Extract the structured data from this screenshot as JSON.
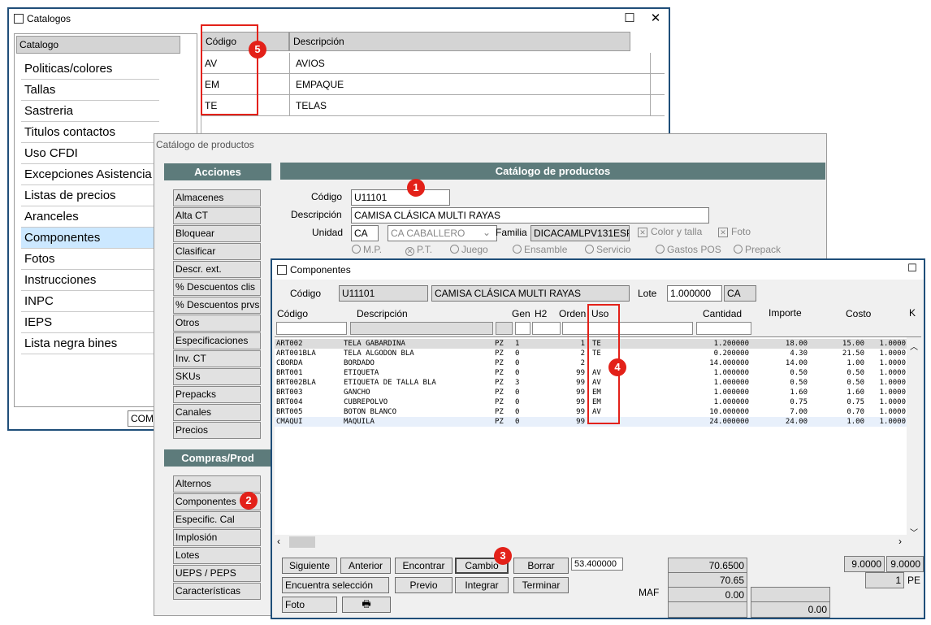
{
  "catalogos": {
    "title": "Catalogos",
    "list_header": "Catalogo",
    "items": [
      "Politicas/colores",
      "Tallas",
      "Sastreria",
      "Titulos contactos",
      "Uso CFDI",
      "Excepciones Asistencia",
      "Listas de precios",
      "Aranceles",
      "Componentes",
      "Fotos",
      "Instrucciones",
      "INPC",
      "IEPS",
      "Lista negra bines"
    ],
    "selected_index": 8,
    "grid_headers": [
      "Código",
      "Descripción"
    ],
    "rows": [
      {
        "code": "AV",
        "desc": "AVIOS"
      },
      {
        "code": "EM",
        "desc": "EMPAQUE"
      },
      {
        "code": "TE",
        "desc": "TELAS"
      }
    ],
    "bottom_field": "COM"
  },
  "productos": {
    "title": "Catálogo de productos",
    "acciones_header": "Acciones",
    "main_header": "Catálogo de productos",
    "acciones": [
      "Almacenes",
      "Alta CT",
      "Bloquear",
      "Clasificar",
      "Descr. ext.",
      "% Descuentos clis",
      "% Descuentos prvs",
      "Otros",
      "Especificaciones",
      "Inv. CT",
      "SKUs",
      "Prepacks",
      "Canales",
      "Precios"
    ],
    "compras_header": "Compras/Prod",
    "compras": [
      "Alternos",
      "Componentes",
      "Especific. Cal",
      "Implosión",
      "Lotes",
      "UEPS / PEPS",
      "Características"
    ],
    "codigo_label": "Código",
    "codigo_value": "U11101",
    "descripcion_label": "Descripción",
    "descripcion_value": "CAMISA CLÁSICA MULTI RAYAS",
    "unidad_label": "Unidad",
    "unidad_value": "CA",
    "unidad_select": "CA  CABALLERO",
    "familia_label": "Familia",
    "familia_value": "DICACAMLPV131ESP",
    "check_color": "Color y talla",
    "check_foto": "Foto",
    "radios": [
      "M.P.",
      "P.T.",
      "Juego",
      "Ensamble",
      "Servicio",
      "Gastos POS",
      "Prepack"
    ],
    "radio_selected": 1
  },
  "componentes": {
    "title": "Componentes",
    "codigo_label": "Código",
    "codigo_value": "U11101",
    "desc_value": "CAMISA CLÁSICA MULTI RAYAS",
    "lote_label": "Lote",
    "lote_value": "1.000000",
    "lote_unit": "CA",
    "headers": {
      "codigo": "Código",
      "descripcion": "Descripción",
      "gen": "Gen",
      "h2": "H2",
      "orden": "Orden",
      "uso": "Uso",
      "cantidad": "Cantidad",
      "importe": "Importe",
      "costo": "Costo",
      "k": "K"
    },
    "rows": [
      {
        "codigo": "ART002",
        "desc": "TELA GABARDINA",
        "um": "PZ",
        "gen": "1",
        "orden": "1",
        "uso": "TE",
        "cantidad": "1.200000",
        "importe": "18.00",
        "costo": "15.00",
        "k": "1.0000"
      },
      {
        "codigo": "ART001BLA",
        "desc": "TELA ALGODON BLA",
        "um": "PZ",
        "gen": "0",
        "orden": "2",
        "uso": "TE",
        "cantidad": "0.200000",
        "importe": "4.30",
        "costo": "21.50",
        "k": "1.0000"
      },
      {
        "codigo": "CBORDA",
        "desc": "BORDADO",
        "um": "PZ",
        "gen": "0",
        "orden": "2",
        "uso": "",
        "cantidad": "14.000000",
        "importe": "14.00",
        "costo": "1.00",
        "k": "1.0000"
      },
      {
        "codigo": "BRT001",
        "desc": "ETIQUETA",
        "um": "PZ",
        "gen": "0",
        "orden": "99",
        "uso": "AV",
        "cantidad": "1.000000",
        "importe": "0.50",
        "costo": "0.50",
        "k": "1.0000"
      },
      {
        "codigo": "BRT002BLA",
        "desc": "ETIQUETA DE TALLA BLA",
        "um": "PZ",
        "gen": "3",
        "orden": "99",
        "uso": "AV",
        "cantidad": "1.000000",
        "importe": "0.50",
        "costo": "0.50",
        "k": "1.0000"
      },
      {
        "codigo": "BRT003",
        "desc": "GANCHO",
        "um": "PZ",
        "gen": "0",
        "orden": "99",
        "uso": "EM",
        "cantidad": "1.000000",
        "importe": "1.60",
        "costo": "1.60",
        "k": "1.0000"
      },
      {
        "codigo": "BRT004",
        "desc": "CUBREPOLVO",
        "um": "PZ",
        "gen": "0",
        "orden": "99",
        "uso": "EM",
        "cantidad": "1.000000",
        "importe": "0.75",
        "costo": "0.75",
        "k": "1.0000"
      },
      {
        "codigo": "BRT005",
        "desc": "BOTON BLANCO",
        "um": "PZ",
        "gen": "0",
        "orden": "99",
        "uso": "AV",
        "cantidad": "10.000000",
        "importe": "7.00",
        "costo": "0.70",
        "k": "1.0000"
      },
      {
        "codigo": "CMAQUI",
        "desc": "MAQUILA",
        "um": "PZ",
        "gen": "0",
        "orden": "99",
        "uso": "",
        "cantidad": "24.000000",
        "importe": "24.00",
        "costo": "1.00",
        "k": "1.0000"
      }
    ],
    "buttons": {
      "siguiente": "Siguiente",
      "anterior": "Anterior",
      "encontrar": "Encontrar",
      "cambio": "Cambio",
      "borrar": "Borrar",
      "encuentra": "Encuentra selección",
      "previo": "Previo",
      "integrar": "Integrar",
      "terminar": "Terminar",
      "foto": "Foto"
    },
    "borrar_value": "53.400000",
    "total1": "70.6500",
    "total2": "70.65",
    "total3": "0.00",
    "total4": "0.00",
    "maf_label": "MAF",
    "right1": "9.0000",
    "right2": "9.0000",
    "right3": "1",
    "pe_label": "PE"
  },
  "badges": [
    "1",
    "2",
    "3",
    "4",
    "5"
  ],
  "colors": {
    "accent": "#e32119",
    "frame": "#1f4e79",
    "header_bg": "#5d7b7b",
    "selection": "#cce8ff"
  }
}
